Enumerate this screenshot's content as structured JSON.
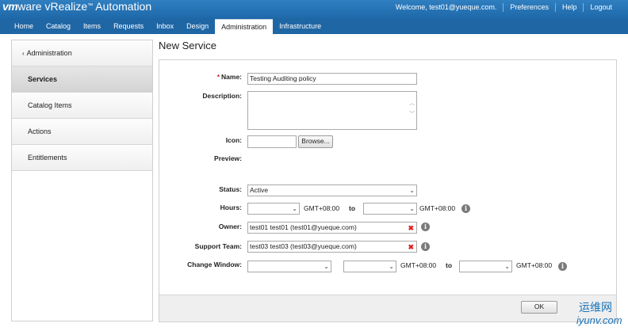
{
  "header": {
    "logo_brand": "vm",
    "logo_ware": "ware",
    "logo_product": " vRealize",
    "logo_tm": "™",
    "logo_suffix": " Automation",
    "welcome": "Welcome, test01@yueque.com.",
    "preferences": "Preferences",
    "help": "Help",
    "logout": "Logout"
  },
  "nav": {
    "tabs": [
      "Home",
      "Catalog",
      "Items",
      "Requests",
      "Inbox",
      "Design",
      "Administration",
      "Infrastructure"
    ],
    "active": "Administration"
  },
  "sidebar": {
    "back_label": "Administration",
    "items": [
      "Services",
      "Catalog Items",
      "Actions",
      "Entitlements"
    ],
    "active": "Services"
  },
  "page": {
    "title": "New Service"
  },
  "form": {
    "name_required": "*",
    "name_label": "Name:",
    "name_value": "Testing Auditing policy",
    "description_label": "Description:",
    "description_value": "",
    "icon_label": "Icon:",
    "icon_value": "",
    "browse_label": "Browse...",
    "preview_label": "Preview:",
    "status_label": "Status:",
    "status_value": "Active",
    "hours_label": "Hours:",
    "hours_from": "",
    "hours_to": "",
    "timezone": "GMT+08:00",
    "to_label": "to",
    "owner_label": "Owner:",
    "owner_value": "test01 test01 (test01@yueque.com)",
    "support_label": "Support Team:",
    "support_value": "test03 test03 (test03@yueque.com)",
    "change_window_label": "Change Window:",
    "change_day_from": "",
    "change_time_from": "",
    "change_time_to": "",
    "ok_label": "OK"
  },
  "icons": {
    "info": "info-icon",
    "remove": "remove-x-icon",
    "dropdown": "chevron-down-icon"
  },
  "watermark": {
    "line1": "运维网",
    "line2": "iyunv.com"
  },
  "colors": {
    "header": "#1f66a5",
    "accent": "#2f7fc1",
    "required": "#cc2222",
    "remove": "#dd2222"
  }
}
